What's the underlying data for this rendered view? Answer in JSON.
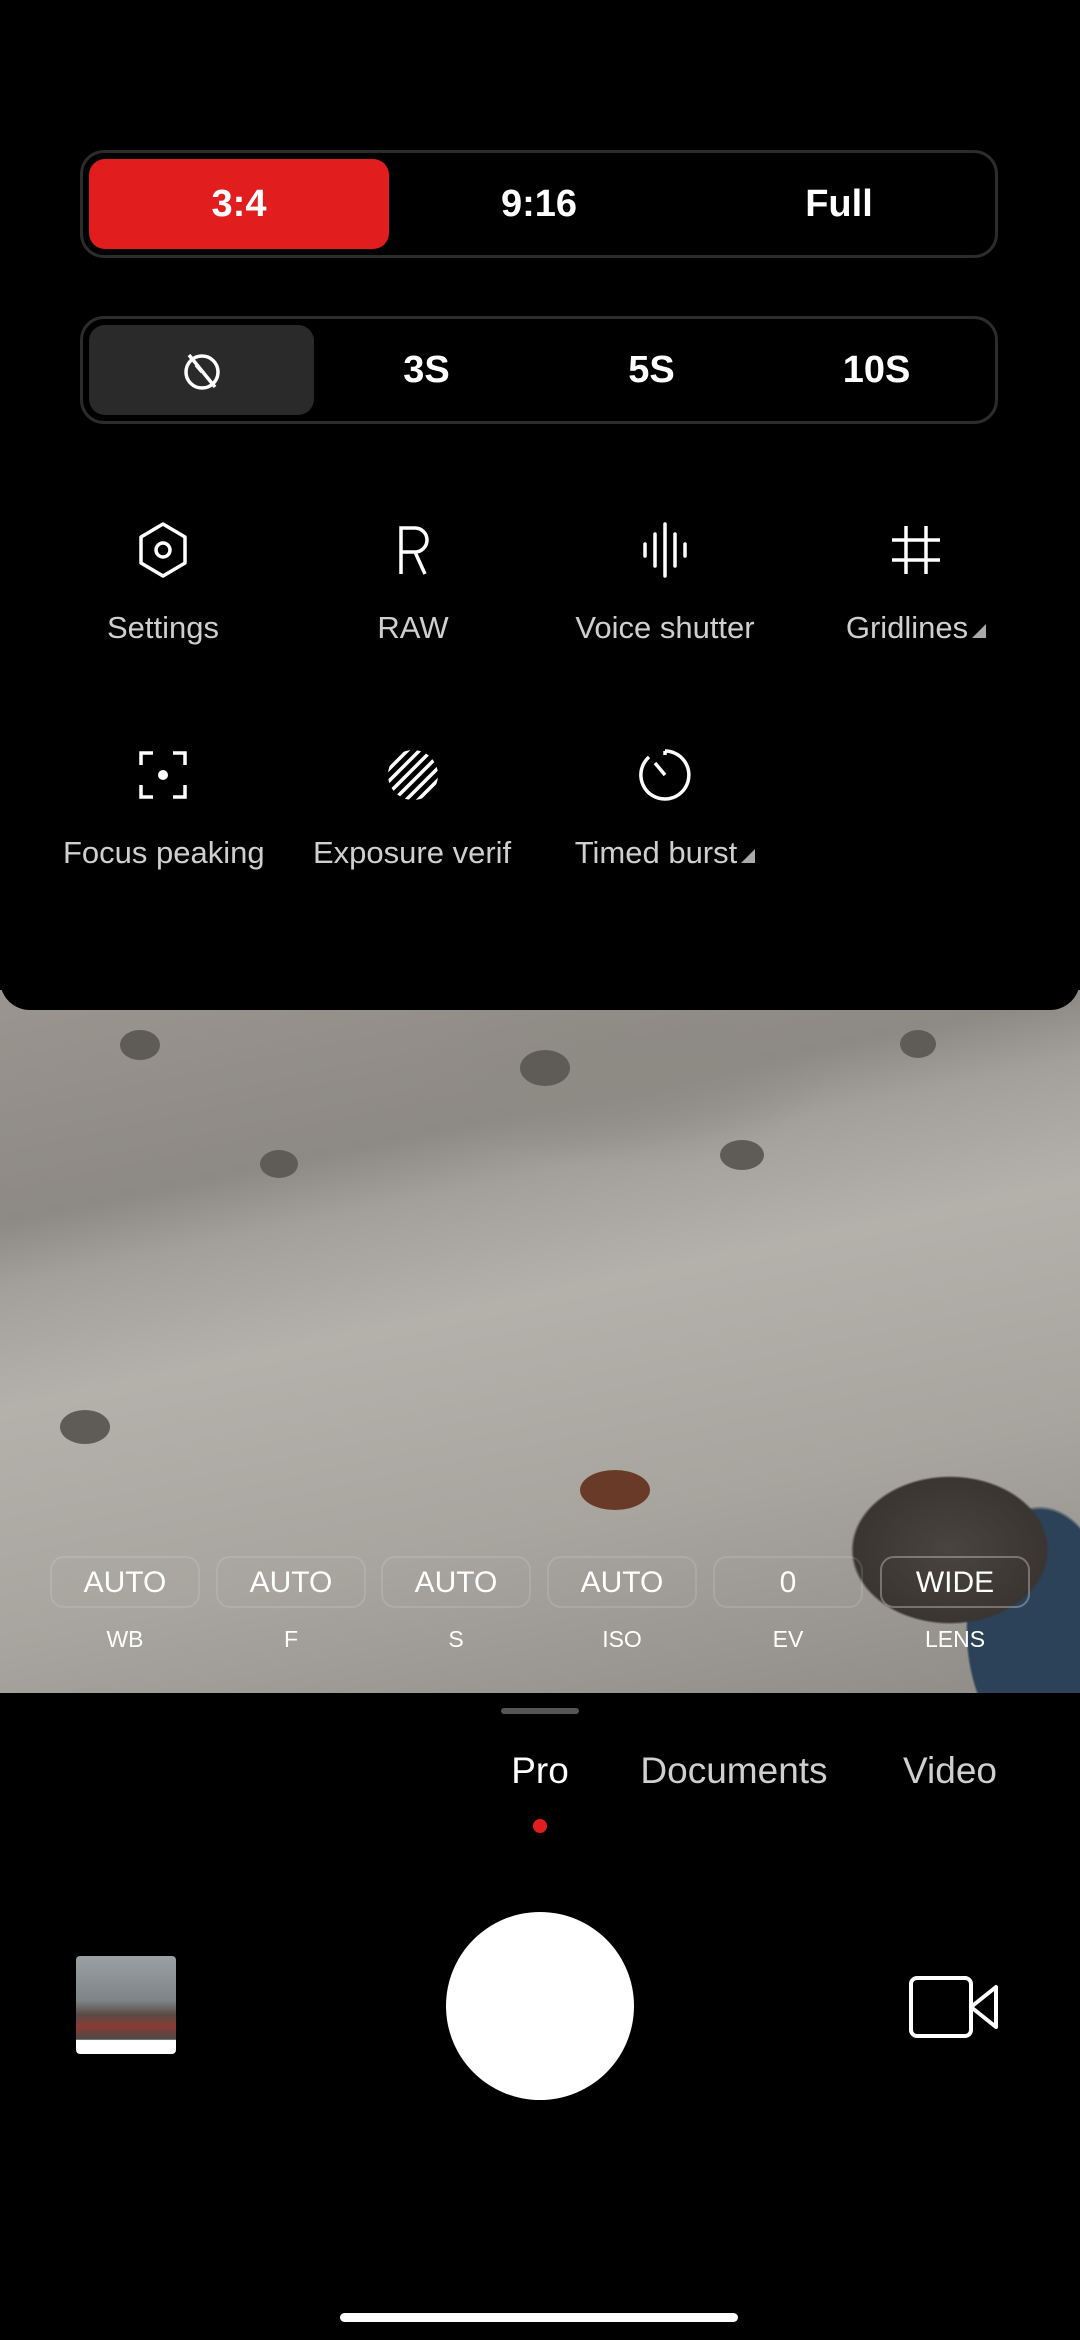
{
  "aspect_ratio": {
    "options": [
      "3:4",
      "9:16",
      "Full"
    ],
    "selected": "3:4",
    "accent": "#e21d1d"
  },
  "timer": {
    "options": [
      "off",
      "3S",
      "5S",
      "10S"
    ],
    "selected": "off"
  },
  "tools": [
    {
      "label": "Settings",
      "icon": "settings-hexagon-icon"
    },
    {
      "label": "RAW",
      "icon": "raw-icon"
    },
    {
      "label": "Voice shutter",
      "icon": "voice-wave-icon"
    },
    {
      "label": "Gridlines",
      "icon": "grid-icon",
      "has_menu": true
    },
    {
      "label": "Focus peaking",
      "icon": "focus-peaking-icon"
    },
    {
      "label": "Exposure verification",
      "icon": "exposure-stripes-icon"
    },
    {
      "label": "Timed burst",
      "icon": "timer-icon",
      "has_menu": true
    }
  ],
  "pro_controls": [
    {
      "value": "AUTO",
      "label": "WB"
    },
    {
      "value": "AUTO",
      "label": "F"
    },
    {
      "value": "AUTO",
      "label": "S"
    },
    {
      "value": "AUTO",
      "label": "ISO"
    },
    {
      "value": "0",
      "label": "EV"
    },
    {
      "value": "WIDE",
      "label": "LENS"
    }
  ],
  "modes": {
    "items": [
      "Pro",
      "Documents",
      "Video"
    ],
    "selected": "Pro",
    "indicator_color": "#e21d1d"
  }
}
